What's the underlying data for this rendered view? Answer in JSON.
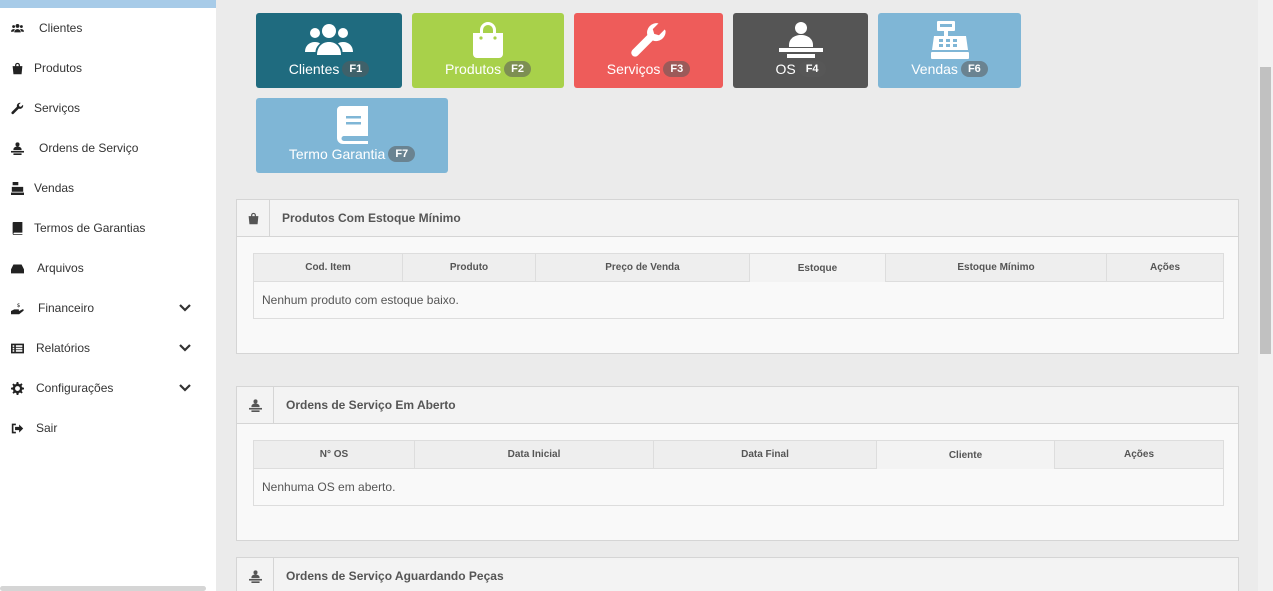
{
  "sidebar": {
    "items": [
      {
        "label": "Clientes",
        "icon": "users-icon"
      },
      {
        "label": "Produtos",
        "icon": "shopping-bag-icon"
      },
      {
        "label": "Serviços",
        "icon": "wrench-icon"
      },
      {
        "label": "Ordens de Serviço",
        "icon": "technician-icon"
      },
      {
        "label": "Vendas",
        "icon": "cash-register-icon"
      },
      {
        "label": "Termos de Garantias",
        "icon": "book-icon"
      },
      {
        "label": "Arquivos",
        "icon": "hdd-icon"
      },
      {
        "label": "Financeiro",
        "icon": "hand-dollar-icon",
        "expandable": true
      },
      {
        "label": "Relatórios",
        "icon": "list-icon",
        "expandable": true
      },
      {
        "label": "Configurações",
        "icon": "gear-icon",
        "expandable": true
      },
      {
        "label": "Sair",
        "icon": "sign-out-icon"
      }
    ]
  },
  "shortcuts": [
    {
      "label": "Clientes",
      "key": "F1",
      "color": "#1f6b7f",
      "icon": "users-icon"
    },
    {
      "label": "Produtos",
      "key": "F2",
      "color": "#a8d14a",
      "icon": "shopping-bag-icon"
    },
    {
      "label": "Serviços",
      "key": "F3",
      "color": "#ee5c5a",
      "icon": "wrench-icon"
    },
    {
      "label": "OS",
      "key": "F4",
      "color": "#555555",
      "icon": "technician-icon"
    },
    {
      "label": "Vendas",
      "key": "F6",
      "color": "#7fb6d6",
      "icon": "cash-register-icon"
    },
    {
      "label": "Termo Garantia",
      "key": "F7",
      "color": "#7fb6d6",
      "icon": "book-icon"
    }
  ],
  "panels": {
    "estoque": {
      "title": "Produtos Com Estoque Mínimo",
      "columns": [
        "Cod. Item",
        "Produto",
        "Preço de Venda",
        "Estoque",
        "Estoque Mínimo",
        "Ações"
      ],
      "empty": "Nenhum produto com estoque baixo."
    },
    "os_aberto": {
      "title": "Ordens de Serviço Em Aberto",
      "columns": [
        "N° OS",
        "Data Inicial",
        "Data Final",
        "Cliente",
        "Ações"
      ],
      "empty": "Nenhuma OS em aberto."
    },
    "os_pecas": {
      "title": "Ordens de Serviço Aguardando Peças"
    }
  }
}
